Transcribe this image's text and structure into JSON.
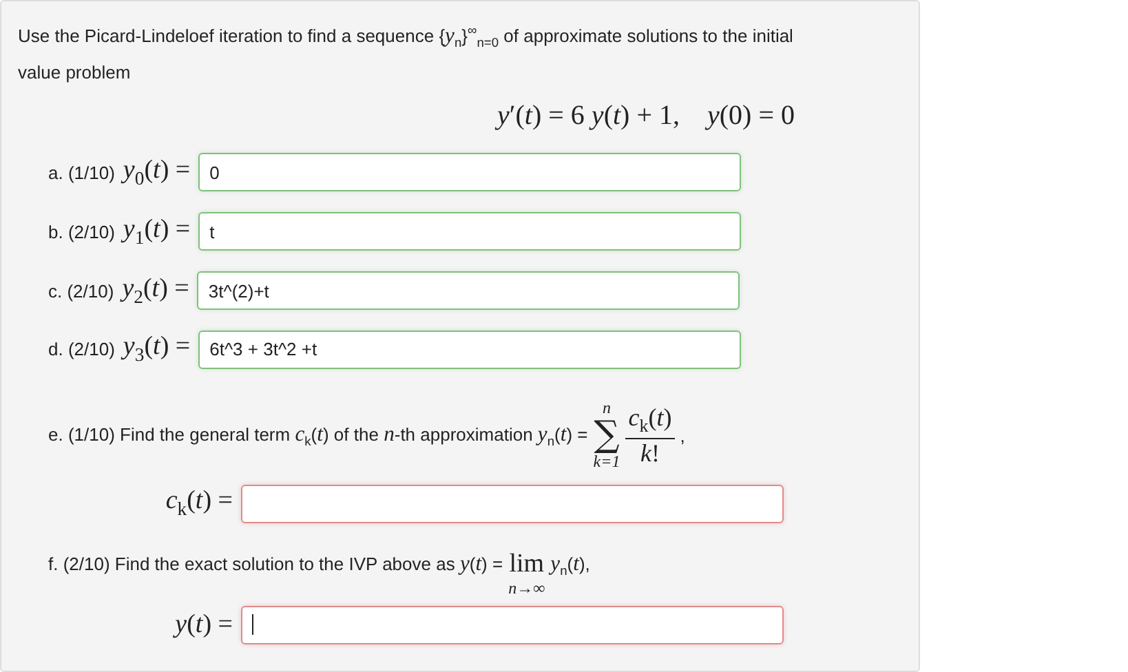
{
  "intro": "Use the Picard-Lindeloef iteration to find a sequence {*y*$_{n}$}$^{∞}$$_{n=0}$ of approximate solutions to the initial value problem",
  "equation": "*y*′(*t*) = 6 *y*(*t*) + 1,    *y*(0) = 0",
  "answers": [
    {
      "label": "a. (1/10)",
      "lhs": "*y*$_{0}$(*t*) =",
      "value": "0",
      "correct": true
    },
    {
      "label": "b. (2/10)",
      "lhs": "*y*$_{1}$(*t*) =",
      "value": "t",
      "correct": true
    },
    {
      "label": "c. (2/10)",
      "lhs": "*y*$_{2}$(*t*) =",
      "value": "3t^(2)+t",
      "correct": true
    },
    {
      "label": "d. (2/10)",
      "lhs": "*y*$_{3}$(*t*) =",
      "value": "6t^3 + 3t^2 +t",
      "correct": true
    }
  ],
  "part_e": {
    "prompt": "e. (1/10) Find the general term *c*$_{k}$(*t*) of the *n*-th approximation *y*$_{n}$(*t*) =",
    "sum_upper": "n",
    "sum_sign": "∑",
    "sum_lower": "k=1",
    "numerator": "*c*$_{k}$(*t*)",
    "denominator": "*k*!",
    "trail": ",",
    "field": {
      "lhs": "*c*$_{k}$(*t*) =",
      "correct": false,
      "focused": false
    }
  },
  "part_f": {
    "prompt": "f. (2/10) Find the exact solution to the IVP above as *y*(*t*) =",
    "lim": "lim",
    "lim_under": "n→∞",
    "tail": "*y*$_{n}$(*t*),",
    "field": {
      "lhs": "*y*(*t*) =",
      "correct": false,
      "focused": true
    }
  }
}
